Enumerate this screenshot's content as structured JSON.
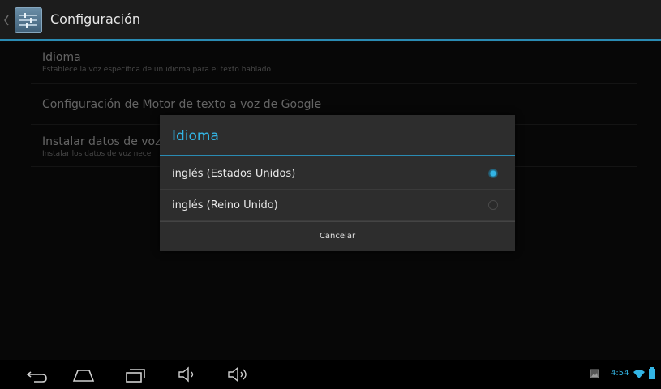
{
  "action_bar": {
    "title": "Configuración",
    "icon": "settings-app-icon"
  },
  "settings": [
    {
      "title": "Idioma",
      "summary": "Establece la voz específica de un idioma para el texto hablado"
    },
    {
      "title": "Configuración de Motor de texto a voz de Google"
    },
    {
      "title": "Instalar datos de voz",
      "summary": "Instalar los datos de voz nece"
    }
  ],
  "dialog": {
    "title": "Idioma",
    "options": [
      {
        "label": "inglés (Estados Unidos)",
        "selected": true
      },
      {
        "label": "inglés (Reino Unido)",
        "selected": false
      }
    ],
    "cancel_label": "Cancelar"
  },
  "nav_bar": {
    "icons": [
      "back-icon",
      "home-icon",
      "recent-apps-icon",
      "volume-down-icon",
      "volume-up-icon"
    ],
    "status": {
      "time": "4:54",
      "icons": [
        "gallery-notification-icon",
        "wifi-icon",
        "battery-icon"
      ]
    }
  },
  "colors": {
    "accent": "#33b5e5",
    "divider": "#2a8bb3",
    "dialog_bg": "#2d2d2d",
    "screen_bg": "#0b0b0b"
  }
}
